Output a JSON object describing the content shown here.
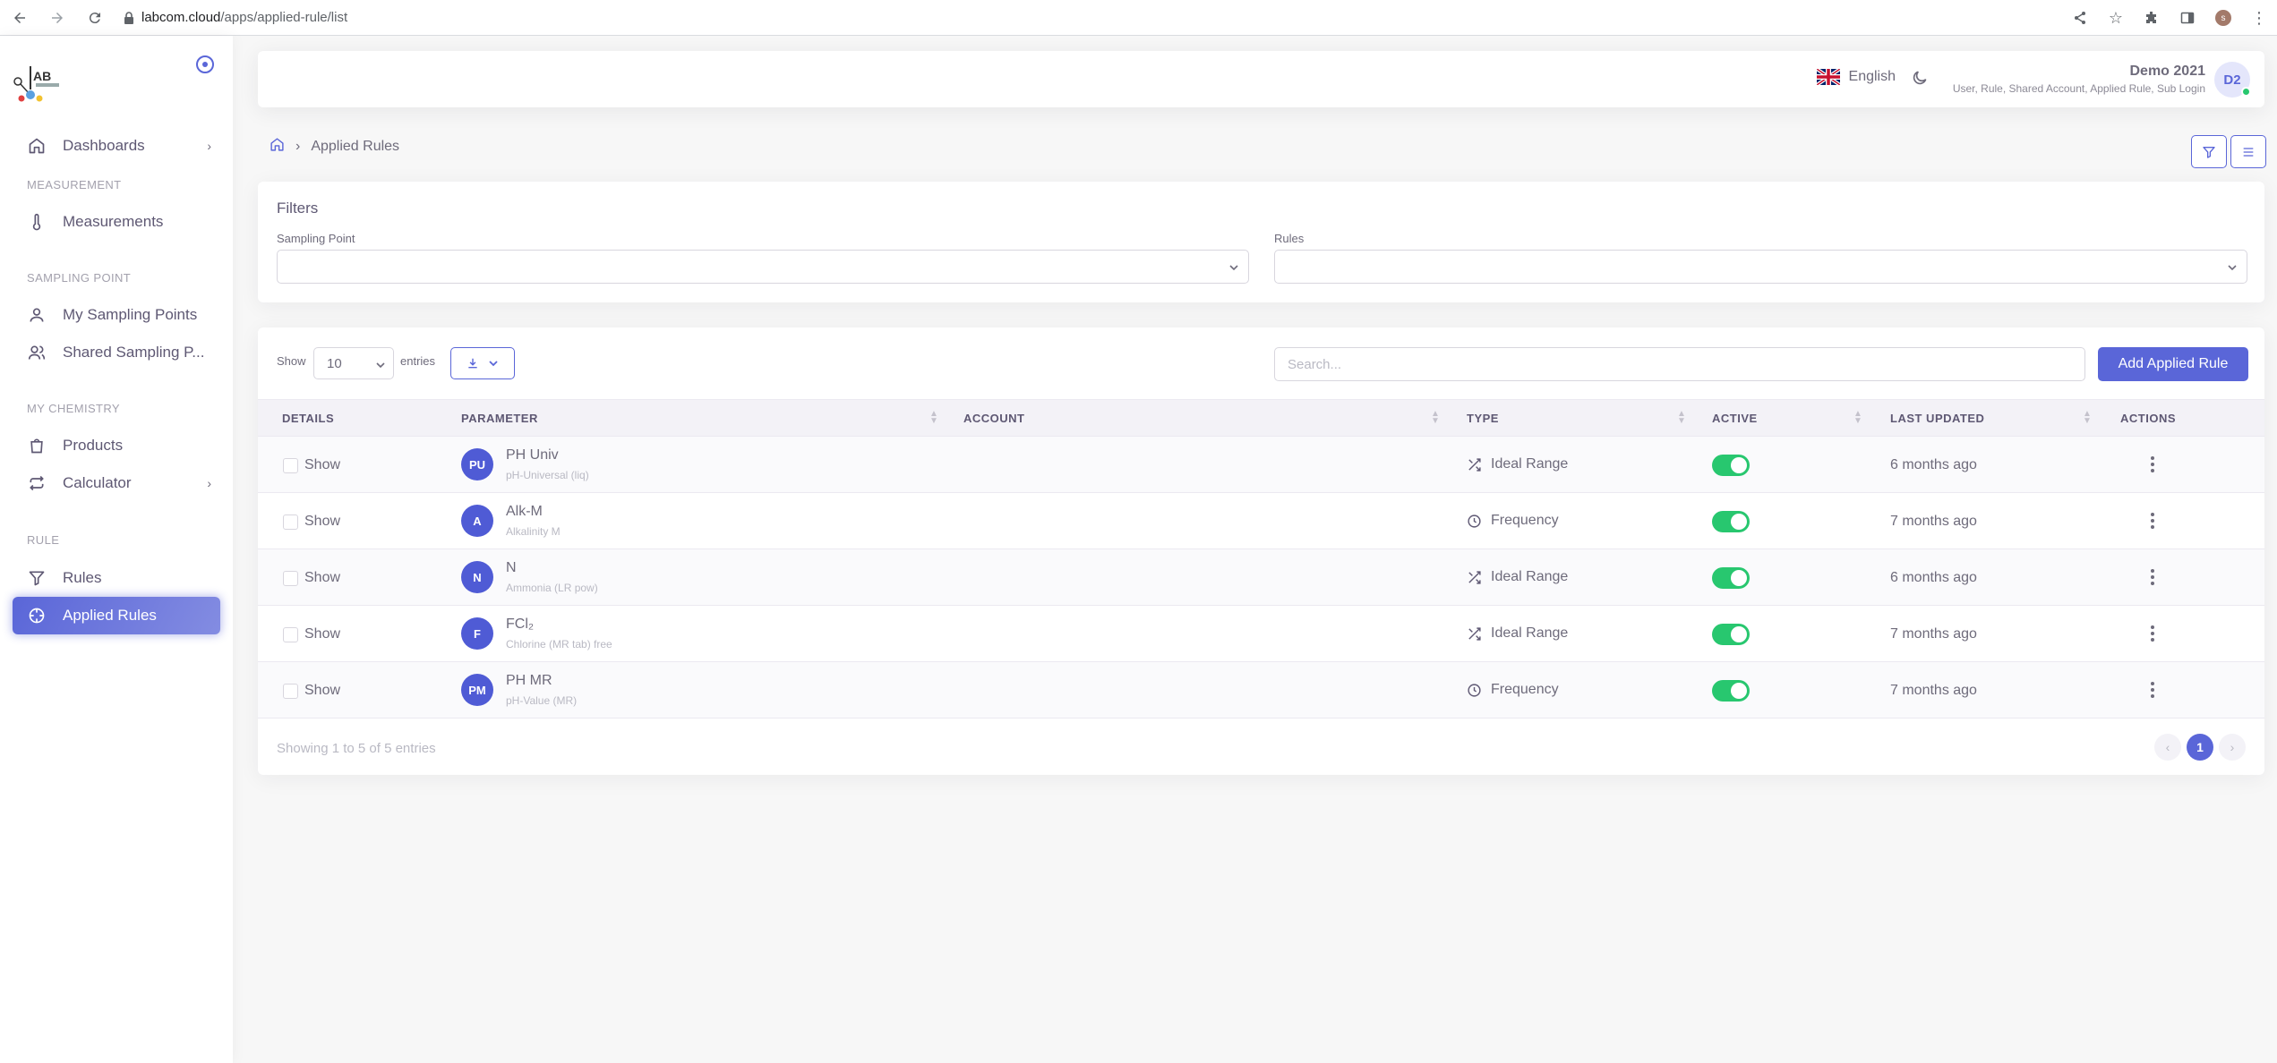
{
  "browser": {
    "url_host": "labcom.cloud",
    "url_path": "/apps/applied-rule/list",
    "profile_initial": "s"
  },
  "sidebar": {
    "items": [
      {
        "label": "Dashboards"
      },
      {
        "label": "Measurements"
      },
      {
        "label": "My Sampling Points"
      },
      {
        "label": "Shared Sampling P..."
      },
      {
        "label": "Products"
      },
      {
        "label": "Calculator"
      },
      {
        "label": "Rules"
      },
      {
        "label": "Applied Rules"
      }
    ],
    "sections": [
      "MEASUREMENT",
      "SAMPLING POINT",
      "MY CHEMISTRY",
      "RULE"
    ]
  },
  "header": {
    "language": "English",
    "user_name": "Demo 2021",
    "user_roles": "User, Rule, Shared Account, Applied Rule, Sub Login",
    "avatar_initials": "D2"
  },
  "breadcrumb": {
    "current": "Applied Rules"
  },
  "filters": {
    "title": "Filters",
    "sampling_point_label": "Sampling Point",
    "rules_label": "Rules"
  },
  "table": {
    "show_label": "Show",
    "page_length": "10",
    "entries_label": "entries",
    "search_placeholder": "Search...",
    "add_button": "Add Applied Rule",
    "columns": [
      "DETAILS",
      "PARAMETER",
      "ACCOUNT",
      "TYPE",
      "ACTIVE",
      "LAST UPDATED",
      "ACTIONS"
    ],
    "rows": [
      {
        "show": "Show",
        "initials": "PU",
        "param": "PH Univ",
        "sub": "pH-Universal (liq)",
        "type": "Ideal Range",
        "updated": "6 months ago",
        "active": true
      },
      {
        "show": "Show",
        "initials": "A",
        "param": "Alk-M",
        "sub": "Alkalinity M",
        "type": "Frequency",
        "updated": "7 months ago",
        "active": true
      },
      {
        "show": "Show",
        "initials": "N",
        "param": "N",
        "sub": "Ammonia (LR pow)",
        "type": "Ideal Range",
        "updated": "6 months ago",
        "active": true
      },
      {
        "show": "Show",
        "initials": "F",
        "param": "FCl₂",
        "sub": "Chlorine (MR tab) free",
        "type": "Ideal Range",
        "updated": "7 months ago",
        "active": true
      },
      {
        "show": "Show",
        "initials": "PM",
        "param": "PH MR",
        "sub": "pH-Value (MR)",
        "type": "Frequency",
        "updated": "7 months ago",
        "active": true
      }
    ],
    "footer_info": "Showing 1 to 5 of 5 entries",
    "current_page": "1"
  },
  "colors": {
    "primary": "#5a66d8",
    "success": "#28c76f",
    "avatar_bg": "#4f5bd5"
  }
}
